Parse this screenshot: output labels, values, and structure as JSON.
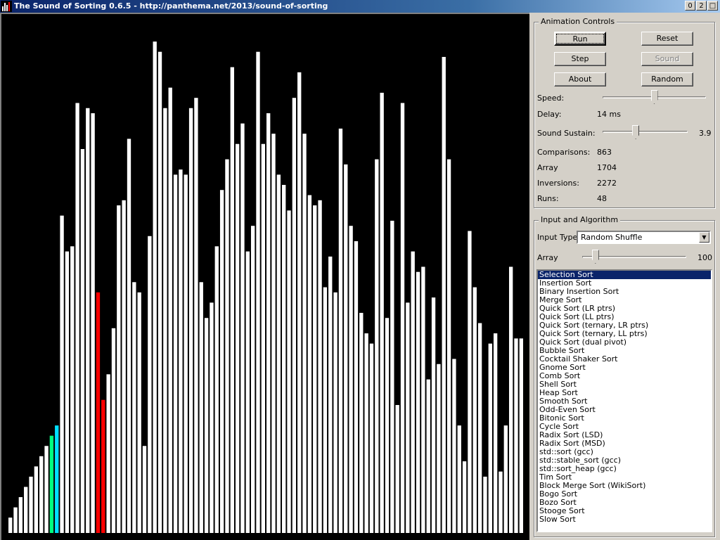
{
  "window": {
    "title": "The Sound of Sorting 0.6.5 - http://panthema.net/2013/sound-of-sorting",
    "buttons": [
      "0",
      "2",
      "□"
    ]
  },
  "animation_controls": {
    "heading": "Animation Controls",
    "buttons": {
      "run": "Run",
      "reset": "Reset",
      "step": "Step",
      "sound": "Sound",
      "about": "About",
      "random": "Random"
    },
    "speed_label": "Speed:",
    "speed_level": 0.5,
    "delay_label": "Delay:",
    "delay_value": "14 ms",
    "sustain_label": "Sound Sustain:",
    "sustain_value": "3.9",
    "sustain_level": 0.38,
    "stats": [
      {
        "label": "Comparisons:",
        "value": "863"
      },
      {
        "label": "Array",
        "value": "1704"
      },
      {
        "label": "Inversions:",
        "value": "2272"
      },
      {
        "label": "Runs:",
        "value": "48"
      }
    ]
  },
  "input_algorithm": {
    "heading": "Input and Algorithm",
    "input_type_label": "Input Type:",
    "input_type_value": "Random Shuffle",
    "array_label": "Array",
    "array_value": "100",
    "array_level": 0.1,
    "algorithms": [
      "Selection Sort",
      "Insertion Sort",
      "Binary Insertion Sort",
      "Merge Sort",
      "Quick Sort (LR ptrs)",
      "Quick Sort (LL ptrs)",
      "Quick Sort (ternary, LR ptrs)",
      "Quick Sort (ternary, LL ptrs)",
      "Quick Sort (dual pivot)",
      "Bubble Sort",
      "Cocktail Shaker Sort",
      "Gnome Sort",
      "Comb Sort",
      "Shell Sort",
      "Heap Sort",
      "Smooth Sort",
      "Odd-Even Sort",
      "Bitonic Sort",
      "Cycle Sort",
      "Radix Sort (LSD)",
      "Radix Sort (MSD)",
      "std::sort (gcc)",
      "std::stable_sort (gcc)",
      "std::sort_heap (gcc)",
      "Tim Sort",
      "Block Merge Sort (WikiSort)",
      "Bogo Sort",
      "Bozo Sort",
      "Stooge Sort",
      "Slow Sort"
    ],
    "selected_algorithm": "Selection Sort"
  },
  "colors": {
    "bar": "#ffffff",
    "compare": "#ff0000",
    "sorted_boundary": "#00ff80",
    "pointer": "#00e0ff",
    "background": "#000000"
  },
  "array_values": [
    3,
    5,
    7,
    9,
    11,
    13,
    15,
    17,
    19,
    21,
    62,
    55,
    56,
    84,
    75,
    83,
    82,
    47,
    26,
    31,
    40,
    64,
    65,
    77,
    49,
    47,
    17,
    58,
    96,
    94,
    83,
    87,
    70,
    71,
    70,
    83,
    85,
    49,
    42,
    45,
    56,
    67,
    73,
    91,
    76,
    80,
    55,
    60,
    94,
    76,
    82,
    78,
    70,
    68,
    63,
    85,
    90,
    78,
    66,
    64,
    65,
    48,
    54,
    47,
    79,
    72,
    60,
    57,
    43,
    39,
    37,
    73,
    86,
    42,
    61,
    25,
    84,
    45,
    55,
    51,
    52,
    30,
    46,
    33,
    93,
    73,
    34,
    21,
    14,
    59,
    48,
    41,
    11,
    37,
    39,
    12,
    21,
    52,
    38,
    38
  ],
  "highlights": [
    {
      "index": 8,
      "color_key": "sorted_boundary"
    },
    {
      "index": 9,
      "color_key": "pointer"
    },
    {
      "index": 17,
      "color_key": "compare"
    },
    {
      "index": 18,
      "color_key": "compare"
    }
  ]
}
